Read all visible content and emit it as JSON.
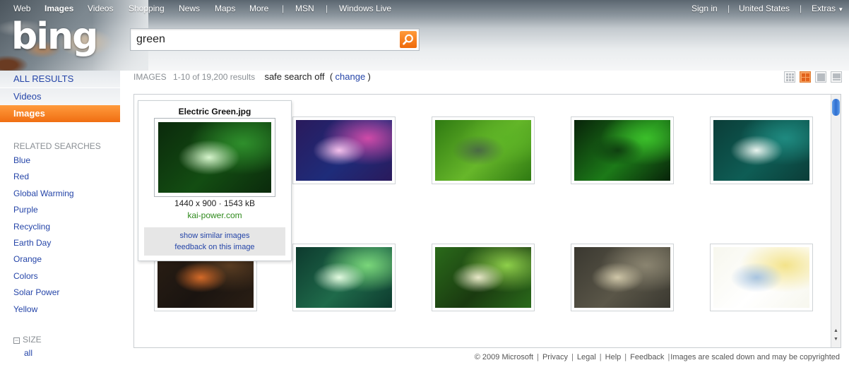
{
  "topnav": {
    "left": [
      "Web",
      "Images",
      "Videos",
      "Shopping",
      "News",
      "Maps",
      "More"
    ],
    "msn": "MSN",
    "windows_live": "Windows Live",
    "right": [
      "Sign in",
      "United States",
      "Extras"
    ],
    "extras_arrow": "▼",
    "separator": "|"
  },
  "logo": {
    "text": "bing"
  },
  "search": {
    "value": "green",
    "button_icon": "magnifier-icon"
  },
  "sidebar": {
    "all_results": "ALL RESULTS",
    "videos": "Videos",
    "images": "Images",
    "related_heading": "RELATED SEARCHES",
    "related": [
      "Blue",
      "Red",
      "Global Warming",
      "Purple",
      "Recycling",
      "Earth Day",
      "Orange",
      "Colors",
      "Solar Power",
      "Yellow"
    ],
    "size_heading": "SIZE",
    "size_toggle": "⊟",
    "size_all": "all"
  },
  "results": {
    "label": "IMAGES",
    "count": "1-10 of 19,200 results",
    "safe": "safe search off",
    "open_paren": "(",
    "change": "change",
    "close_paren": ")"
  },
  "popup": {
    "title": "Electric Green.jpg",
    "dims": "1440 x 900 · 1543 kB",
    "domain": "kai-power.com",
    "show_similar": "show similar images",
    "feedback": "feedback on this image"
  },
  "thumbnails": [
    {
      "name": "electric-green",
      "colors": [
        "#0b2a0c",
        "#2f8f2c",
        "#d6f5cc",
        "#134d12"
      ]
    },
    {
      "name": "mac-desktop",
      "colors": [
        "#2a1a5c",
        "#d04aa8",
        "#f4c0ec",
        "#1e2c7a"
      ]
    },
    {
      "name": "green-stripes",
      "colors": [
        "#2f7a12",
        "#5cb325",
        "#4a6a44",
        "#67b72a"
      ]
    },
    {
      "name": "unreal-tournament",
      "colors": [
        "#08230a",
        "#3bbf2a",
        "#0f3f10",
        "#1c7a18"
      ]
    },
    {
      "name": "teal-abstract",
      "colors": [
        "#0b3d38",
        "#1f8a80",
        "#e9f4ef",
        "#0e5d55"
      ]
    },
    {
      "name": "dark-room",
      "colors": [
        "#2a1e14",
        "#5a3d22",
        "#d46a28",
        "#1a1410"
      ]
    },
    {
      "name": "green-splash",
      "colors": [
        "#0d3a2e",
        "#7ad67a",
        "#e2fbe0",
        "#1f6a4a"
      ]
    },
    {
      "name": "chameleon",
      "colors": [
        "#2a6a1a",
        "#8ed04a",
        "#e8e8c8",
        "#1a3a10"
      ]
    },
    {
      "name": "shooter-game",
      "colors": [
        "#3a3830",
        "#8a8470",
        "#cfc6a8",
        "#5a5648"
      ]
    },
    {
      "name": "nanowrimo-chart",
      "colors": [
        "#f7f7ee",
        "#f3e38a",
        "#a8c4e0",
        "#ffffff"
      ]
    }
  ],
  "footer": {
    "copyright": "© 2009 Microsoft",
    "privacy": "Privacy",
    "legal": "Legal",
    "help": "Help",
    "feedback": "Feedback",
    "notice": "Images are scaled down and may be copyrighted",
    "separator": "|"
  },
  "colors": {
    "accent": "#f06e12",
    "link": "#2545a8",
    "domain_green": "#2f8a1c"
  }
}
